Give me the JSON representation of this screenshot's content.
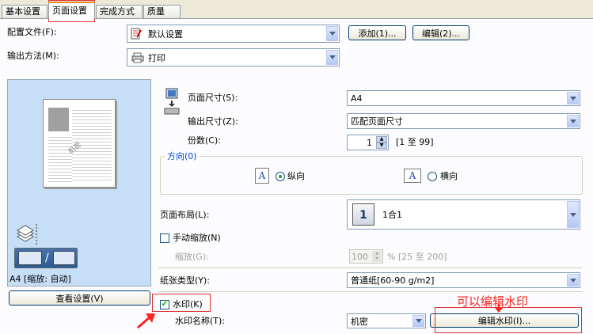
{
  "tabs": [
    "基本设置",
    "页面设置",
    "完成方式",
    "质量"
  ],
  "profile": {
    "label": "配置文件(F):",
    "value": "默认设置",
    "add_btn": "添加(1)...",
    "edit_btn": "编辑(2)..."
  },
  "output_method": {
    "label": "输出方法(M):",
    "value": "打印"
  },
  "preview": {
    "watermark_text": "机密",
    "caption": "A4 [缩放: 自动]",
    "view_btn": "查看设置(V)"
  },
  "page_size": {
    "label": "页面尺寸(S):",
    "value": "A4"
  },
  "output_size": {
    "label": "输出尺寸(Z):",
    "value": "匹配页面尺寸"
  },
  "copies": {
    "label": "份数(C):",
    "value": "1",
    "range": "[1 至 99]"
  },
  "orientation": {
    "title": "方向(0)",
    "portrait_icon": "A",
    "portrait": "纵向",
    "landscape_icon": "A",
    "landscape": "横向"
  },
  "layout": {
    "label": "页面布局(L):",
    "icon_num": "1",
    "value": "1合1"
  },
  "manual_scale": {
    "label": "手动缩放(N)"
  },
  "scale": {
    "label": "缩放(G):",
    "value": "100",
    "range": "% [25 至 200]"
  },
  "paper_type": {
    "label": "纸张类型(Y):",
    "value": "普通纸[60-90 g/m2]"
  },
  "watermark": {
    "label": "水印(K)",
    "name_label": "水印名称(T):",
    "value": "机密",
    "edit_btn": "编辑水印(I)..."
  },
  "annotation": {
    "text": "可以编辑水印"
  },
  "colors": {
    "accent": "#e68b2c",
    "annotation_red": "#ff2222",
    "preview_bg": "#c6def6"
  }
}
